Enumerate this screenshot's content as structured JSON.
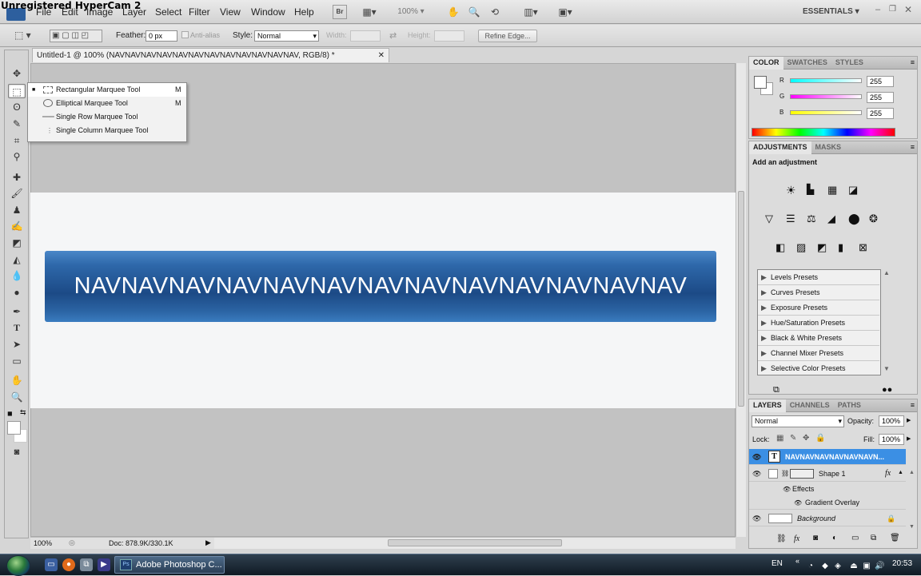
{
  "watermark": "Unregistered HyperCam 2",
  "menu": {
    "items": [
      "File",
      "Edit",
      "Image",
      "Layer",
      "Select",
      "Filter",
      "View",
      "Window",
      "Help"
    ],
    "br": "Br",
    "zoom": "100%",
    "workspace": "ESSENTIALS"
  },
  "options": {
    "feather_label": "Feather:",
    "feather_value": "0 px",
    "antialias_label": "Anti-alias",
    "style_label": "Style:",
    "style_value": "Normal",
    "width_label": "Width:",
    "height_label": "Height:",
    "refine_edge": "Refine Edge..."
  },
  "document": {
    "tab_title": "Untitled-1 @ 100% (NAVNAVNAVNAVNAVNAVNAVNAVNAVNAVNAVNAV, RGB/8) *",
    "banner_text": "NAVNAVNAVNAVNAVNAVNAVNAVNAVNAVNAVNAVNAV"
  },
  "flyout": {
    "items": [
      {
        "label": "Rectangular Marquee Tool",
        "key": "M"
      },
      {
        "label": "Elliptical Marquee Tool",
        "key": "M"
      },
      {
        "label": "Single Row Marquee Tool",
        "key": ""
      },
      {
        "label": "Single Column Marquee Tool",
        "key": ""
      }
    ]
  },
  "status": {
    "zoom": "100%",
    "doc": "Doc: 878.9K/330.1K"
  },
  "color_panel": {
    "tabs": [
      "COLOR",
      "SWATCHES",
      "STYLES"
    ],
    "r_label": "R",
    "g_label": "G",
    "b_label": "B",
    "r": "255",
    "g": "255",
    "b": "255"
  },
  "adjustments_panel": {
    "tabs": [
      "ADJUSTMENTS",
      "MASKS"
    ],
    "heading": "Add an adjustment",
    "presets": [
      "Levels Presets",
      "Curves Presets",
      "Exposure Presets",
      "Hue/Saturation Presets",
      "Black & White Presets",
      "Channel Mixer Presets",
      "Selective Color Presets"
    ]
  },
  "layers_panel": {
    "tabs": [
      "LAYERS",
      "CHANNELS",
      "PATHS"
    ],
    "blend_mode": "Normal",
    "opacity_label": "Opacity:",
    "opacity": "100%",
    "lock_label": "Lock:",
    "fill_label": "Fill:",
    "fill": "100%",
    "layers": {
      "text_layer": "NAVNAVNAVNAVNAVNAVN...",
      "shape_layer": "Shape 1",
      "effects": "Effects",
      "gradient_overlay": "Gradient Overlay",
      "background": "Background"
    }
  },
  "taskbar": {
    "app_button": "Adobe Photoshop C...",
    "lang": "EN",
    "time": "20:53"
  }
}
